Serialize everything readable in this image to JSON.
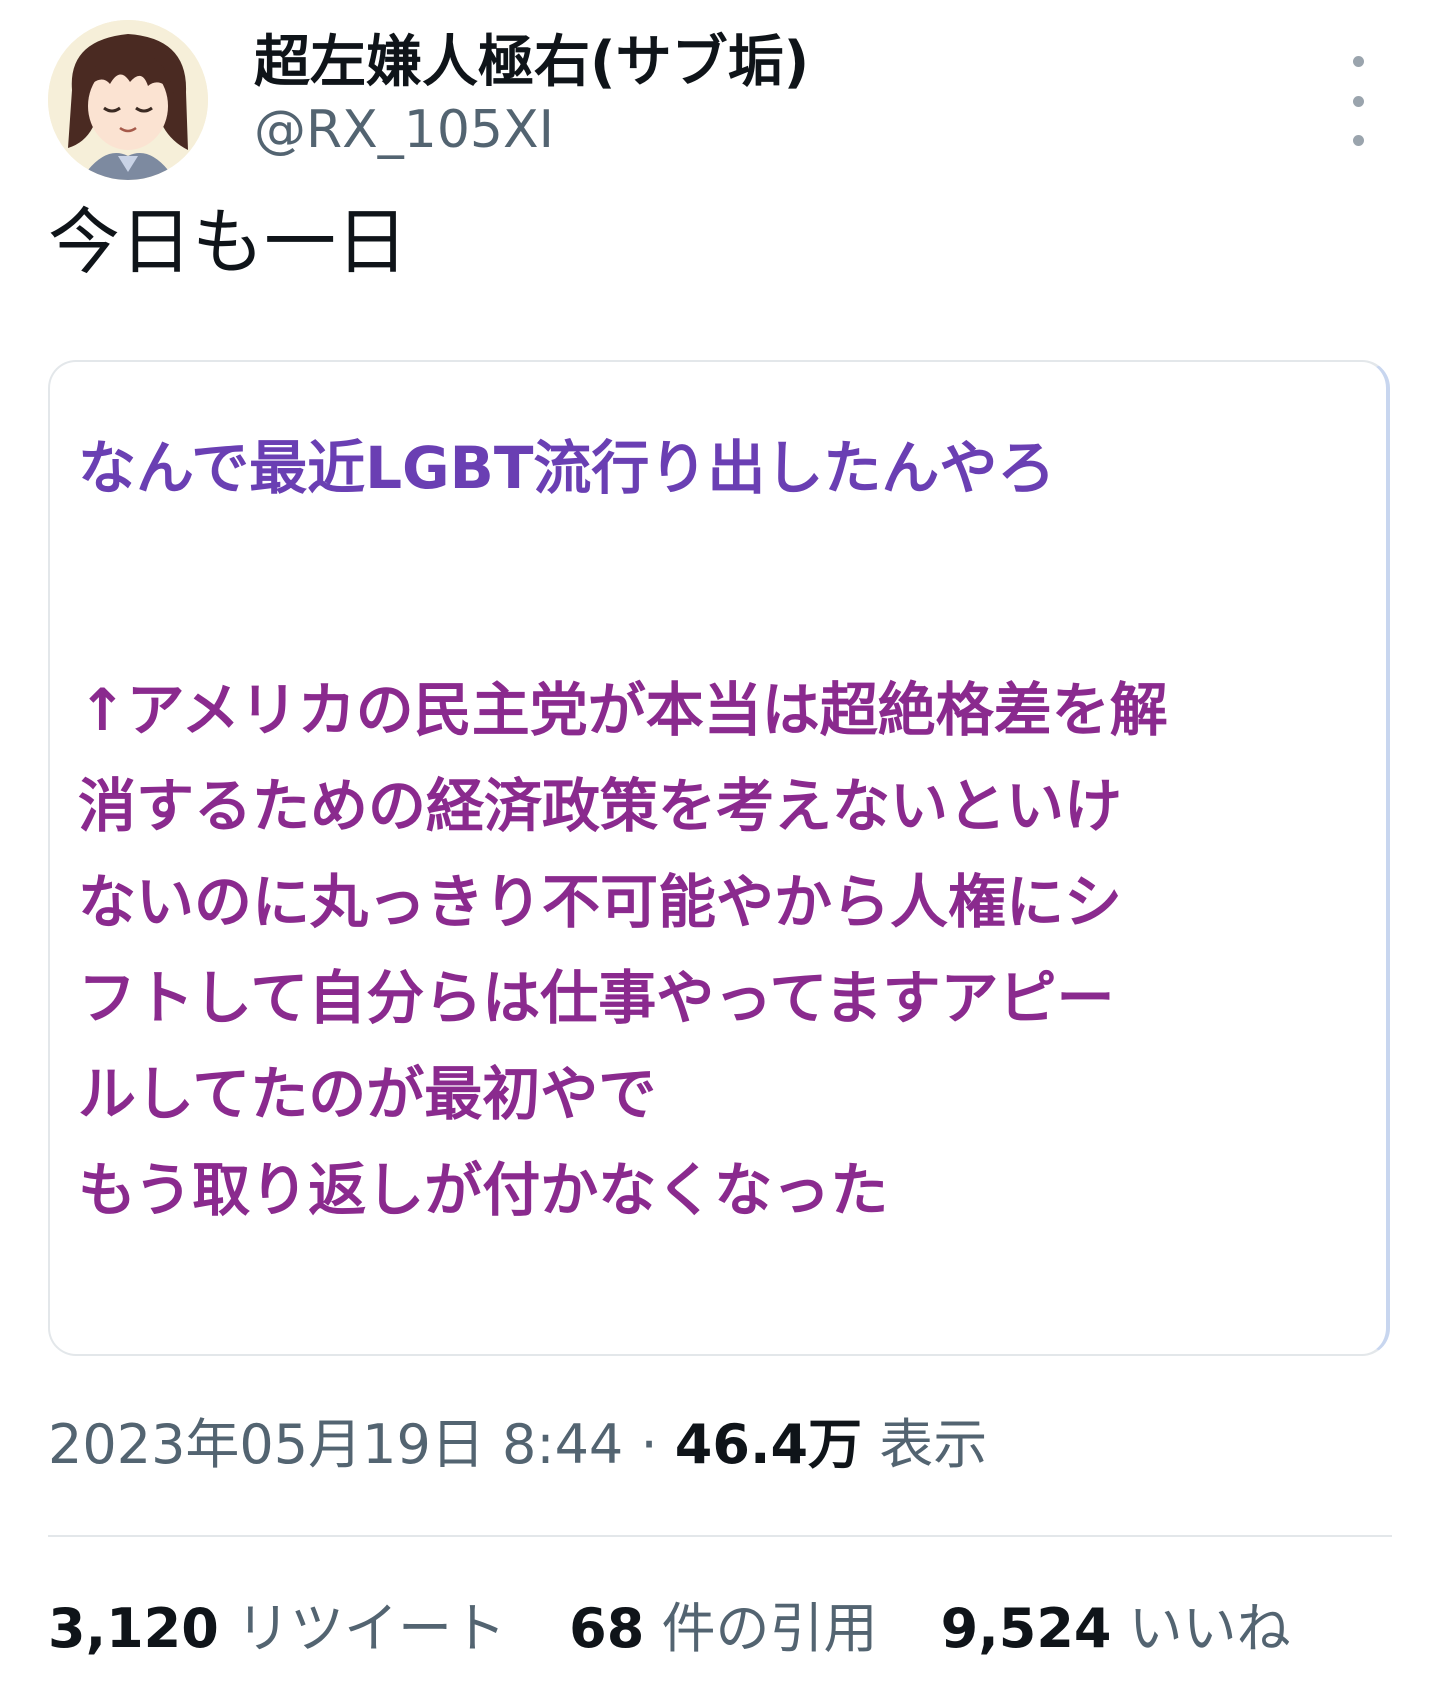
{
  "author": {
    "display_name": "超左嫌人極右(サブ垢)",
    "handle": "@RX_105XI"
  },
  "tweet": {
    "text": "今日も一日"
  },
  "media_card": {
    "headline": "なんで最近LGBT流行り出したんやろ",
    "body_lines": [
      "↑アメリカの民主党が本当は超絶格差を解",
      "消するための経済政策を考えないといけ",
      "ないのに丸っきり不可能やから人権にシ",
      "フトして自分らは仕事やってますアピー",
      "ルしてたのが最初やで",
      "もう取り返しが付かなくなった"
    ]
  },
  "meta": {
    "timestamp": "2023年05月19日 8:44",
    "separator": "·",
    "views_count": "46.4万",
    "views_label": "表示"
  },
  "stats": {
    "retweets": {
      "count": "3,120",
      "label": "リツイート"
    },
    "quotes": {
      "count": "68",
      "label": "件の引用"
    },
    "likes": {
      "count": "9,524",
      "label": "いいね"
    }
  },
  "icons": {
    "more": "more-vertical-icon",
    "avatar": "anime-character-avatar"
  },
  "colors": {
    "headline": "#6a3fb3",
    "body": "#8a2a8e",
    "secondary_text": "#536471"
  }
}
